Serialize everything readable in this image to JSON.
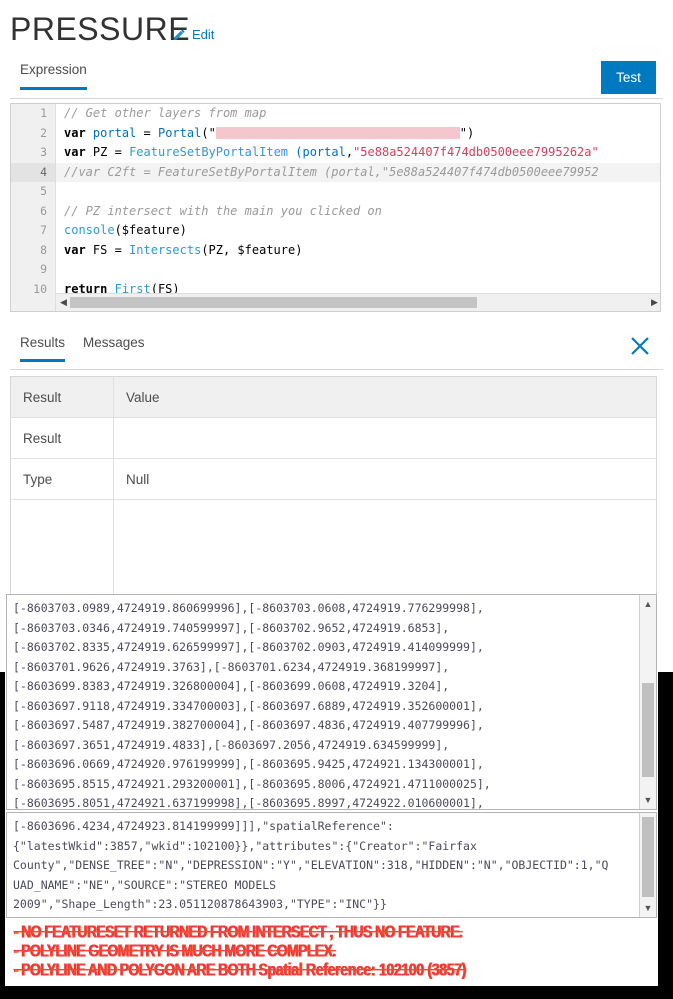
{
  "header": {
    "title": "PRESSURE",
    "edit_label": "Edit",
    "pencil_icon": "pencil-icon"
  },
  "toolbar": {
    "test_label": "Test"
  },
  "tabs": {
    "expression_label": "Expression"
  },
  "editor": {
    "line_numbers": [
      "1",
      "2",
      "3",
      "4",
      "5",
      "6",
      "7",
      "8",
      "9",
      "10"
    ],
    "highlighted_line": "4",
    "lines": [
      "// Get other layers from map",
      "var portal = Portal(\"[REDACTED]\")",
      "var PZ = FeatureSetByPortalItem (portal,\"5e88a524407f474db0500eee7995262a\"",
      "//var C2ft = FeatureSetByPortalItem (portal,\"5e88a524407f474db0500eee79952",
      "",
      "// PZ intersect with the main you clicked on",
      "console($feature)",
      "var FS = Intersects(PZ, $feature)",
      "",
      "return First(FS)"
    ],
    "tokens": {
      "l1_comment": "// Get other layers from map",
      "l2_kw": "var",
      "l2_name": "portal",
      "l2_eq": "=",
      "l2_fn": "Portal",
      "l2_openquote": "(\"",
      "l2_closequote": "\")",
      "l3_kw": "var",
      "l3_name": "PZ",
      "l3_eq": "=",
      "l3_fn": "FeatureSetByPortalItem",
      "l3_open": " (",
      "l3_arg": "portal",
      "l3_comma": ",",
      "l3_str": "\"5e88a524407f474db0500eee7995262a\"",
      "l4_comment": "//var C2ft = FeatureSetByPortalItem (portal,\"5e88a524407f474db0500eee79952",
      "l6_comment": "// PZ intersect with the main you clicked on",
      "l7_fn": "console",
      "l7_rest": "($feature)",
      "l8_kw": "var",
      "l8_name": " FS ",
      "l8_eq": "=",
      "l8_fn": " Intersects",
      "l8_rest": "(PZ, $feature)",
      "l10_kw": "return",
      "l10_fn": "First",
      "l10_rest": "(FS)"
    },
    "hscroll": {
      "left_arrow": "◀",
      "right_arrow": "▶"
    }
  },
  "results_panel": {
    "tabs": [
      {
        "label": "Results",
        "active": true
      },
      {
        "label": "Messages",
        "active": false
      }
    ],
    "close_icon": "close-icon",
    "table": {
      "headers": [
        "Result",
        "Value"
      ],
      "rows": [
        {
          "label": "Result",
          "value": ""
        },
        {
          "label": "Type",
          "value": "Null"
        }
      ]
    }
  },
  "output_geometry": {
    "text": "[-8603703.0989,4724919.860699996],[-8603703.0608,4724919.776299998],\n[-8603703.0346,4724919.740599997],[-8603702.9652,4724919.6853],\n[-8603702.8335,4724919.626599997],[-8603702.0903,4724919.414099999],\n[-8603701.9626,4724919.3763],[-8603701.6234,4724919.368199997],\n[-8603699.8383,4724919.326800004],[-8603699.0608,4724919.3204],\n[-8603697.9118,4724919.334700003],[-8603697.6889,4724919.352600001],\n[-8603697.5487,4724919.382700004],[-8603697.4836,4724919.407799996],\n[-8603697.3651,4724919.4833],[-8603697.2056,4724919.634599999],\n[-8603696.0669,4724920.976199999],[-8603695.9425,4724921.134300001],\n[-8603695.8515,4724921.293200001],[-8603695.8006,4724921.4711000025],\n[-8603695.8051,4724921.637199998],[-8603695.8997,4724922.010600001],",
    "scroll_up_icon": "▲",
    "scroll_down_icon": "▼"
  },
  "output_attributes": {
    "text": "[-8603696.4234,4724923.814199999]]],\"spatialReference\":\n{\"latestWkid\":3857,\"wkid\":102100}},\"attributes\":{\"Creator\":\"Fairfax\nCounty\",\"DENSE_TREE\":\"N\",\"DEPRESSION\":\"Y\",\"ELEVATION\":318,\"HIDDEN\":\"N\",\"OBJECTID\":1,\"Q\nUAD_NAME\":\"NE\",\"SOURCE\":\"STEREO MODELS\n2009\",\"Shape_Length\":23.051120878643903,\"TYPE\":\"INC\"}}",
    "scroll_up_icon": "▲",
    "scroll_down_icon": "▼"
  },
  "annotations": {
    "bullet": "-",
    "line1": "NO FEATURESET RETURNED FROM INTERSECT , THUS NO FEATURE.",
    "line2": "POLYLINE GEOMETRY IS MUCH MORE COMPLEX.",
    "line3_bold": "POLYLINE AND POLYGON ARE BOTH ",
    "line3_rest": "Spatial Reference: 102100  (3857)"
  },
  "colors": {
    "accent_blue": "#0079c1",
    "annotation_red": "#ef3b3b",
    "annotation_orange": "#ff7a3c",
    "redaction_pink": "#f6c6ce",
    "string_red": "#d63c5e",
    "comment_gray": "#9a9a9a"
  }
}
